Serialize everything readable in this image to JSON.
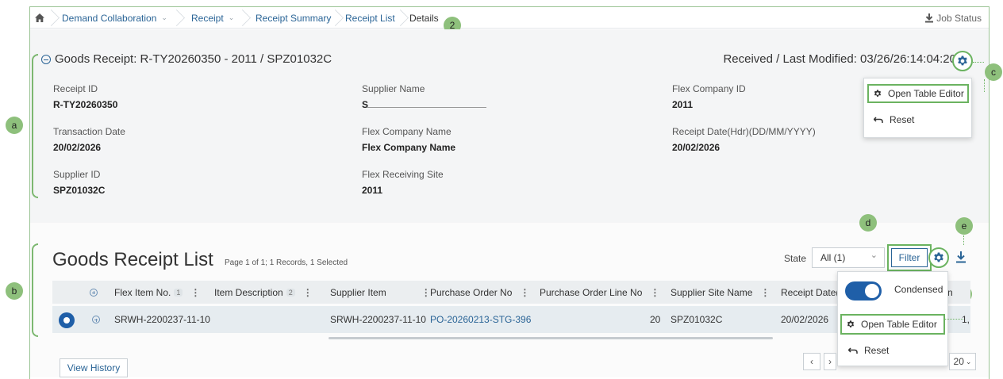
{
  "breadcrumb": {
    "home_icon": "home-icon",
    "items": [
      "Demand Collaboration",
      "Receipt",
      "Receipt Summary",
      "Receipt List",
      "Details"
    ],
    "job_status": "Job Status"
  },
  "header": {
    "title": "Goods Receipt: R-TY20260350 - 2011 / SPZ01032C",
    "status": "Received / Last Modified: 03/26/26:14:04:20"
  },
  "fields": {
    "receipt_id": {
      "label": "Receipt ID",
      "value": "R-TY20260350"
    },
    "supplier_name": {
      "label": "Supplier Name",
      "value": "S"
    },
    "flex_company_id": {
      "label": "Flex Company ID",
      "value": "2011"
    },
    "transaction_date": {
      "label": "Transaction Date",
      "value": "20/02/2026"
    },
    "flex_company_name": {
      "label": "Flex Company Name",
      "value": "Flex Company Name"
    },
    "receipt_date": {
      "label": "Receipt Date(Hdr)(DD/MM/YYYY)",
      "value": "20/02/2026"
    },
    "supplier_id": {
      "label": "Supplier ID",
      "value": "SPZ01032C"
    },
    "flex_receiving_site": {
      "label": "Flex Receiving Site",
      "value": "2011"
    }
  },
  "header_menu": {
    "open_table_editor": "Open Table Editor",
    "reset": "Reset"
  },
  "list": {
    "title": "Goods Receipt List",
    "subtitle": "Page 1 of 1; 1 Records, 1 Selected",
    "state_label": "State",
    "state_value": "All (1)",
    "filter": "Filter",
    "columns": [
      {
        "label": "Flex Item No.",
        "sort": "1"
      },
      {
        "label": "Item Description",
        "sort": "2"
      },
      {
        "label": "Supplier Item",
        "sort": ""
      },
      {
        "label": "Purchase Order No",
        "sort": ""
      },
      {
        "label": "Purchase Order Line No",
        "sort": ""
      },
      {
        "label": "Supplier Site Name",
        "sort": ""
      },
      {
        "label": "Receipt Date(",
        "sort": ""
      },
      {
        "label": "n",
        "sort": ""
      }
    ],
    "row": {
      "flex_item_no": "SRWH-2200237-11-10",
      "item_description": "",
      "supplier_item": "SRWH-2200237-11-10",
      "purchase_order_no": "PO-20260213-STG-396",
      "purchase_order_line_no": "20",
      "supplier_site_name": "SPZ01032C",
      "receipt_date": "20/02/2026",
      "last_col": "1,"
    }
  },
  "list_menu": {
    "condensed": "Condensed",
    "open_table_editor": "Open Table Editor",
    "reset": "Reset"
  },
  "footer": {
    "view_history": "View History",
    "page_size": "20"
  },
  "callouts": {
    "a": "a",
    "b": "b",
    "c1": "c",
    "c2": "c",
    "d": "d",
    "e": "e",
    "two": "2"
  },
  "colors": {
    "accent": "#2a6496",
    "callout": "#8ec07c",
    "highlight": "#6bb360",
    "toggle": "#1f5fa8"
  }
}
